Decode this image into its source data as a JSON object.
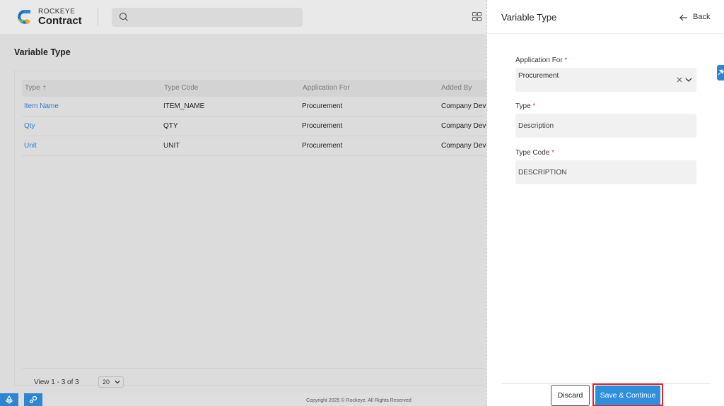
{
  "app": {
    "brand_top": "ROCKEYE",
    "brand_bottom": "Contract"
  },
  "page": {
    "title": "Variable Type"
  },
  "table": {
    "columns": [
      "Type",
      "Type Code",
      "Application For",
      "Added By"
    ],
    "sort_indicator": "⇡",
    "rows": [
      {
        "type": "Item Name",
        "type_code": "ITEM_NAME",
        "application_for": "Procurement",
        "added_by": "Company Deve"
      },
      {
        "type": "Qty",
        "type_code": "QTY",
        "application_for": "Procurement",
        "added_by": "Company Deve"
      },
      {
        "type": "Unit",
        "type_code": "UNIT",
        "application_for": "Procurement",
        "added_by": "Company Deve"
      }
    ],
    "view_count": "View 1 - 3 of 3",
    "page_size": "20"
  },
  "footer": {
    "copyright": "Copyright 2025 © Rockeye. All Rights Reserved"
  },
  "drawer": {
    "title": "Variable Type",
    "back_label": "Back",
    "fields": {
      "application_for": {
        "label": "Application For",
        "value": "Procurement"
      },
      "type": {
        "label": "Type",
        "value": "Description"
      },
      "type_code": {
        "label": "Type Code",
        "value": "DESCRIPTION"
      }
    },
    "required_mark": "*",
    "discard_label": "Discard",
    "save_label": "Save & Continue"
  },
  "colors": {
    "accent": "#2e8fdc",
    "link": "#2d7fd0",
    "required": "#d63b3b",
    "highlight": "#e02020"
  },
  "icons": [
    "search-icon",
    "apps-grid-icon",
    "back-arrow-icon",
    "clear-icon",
    "chevron-down-icon",
    "recycle-icon",
    "settings-icon",
    "pin-icon"
  ]
}
